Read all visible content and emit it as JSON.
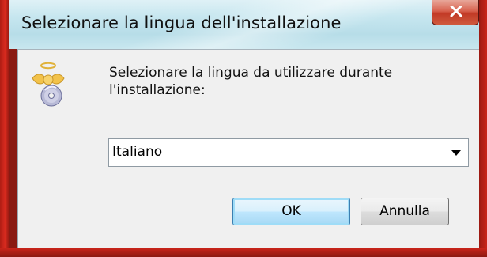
{
  "window": {
    "title": "Selezionare la lingua dell'installazione",
    "close_label": "X"
  },
  "dialog": {
    "prompt": "Selezionare la lingua da utilizzare durante l'installazione:",
    "language_select": {
      "selected": "Italiano"
    },
    "buttons": {
      "ok": "OK",
      "cancel": "Annulla"
    }
  },
  "icons": {
    "app": "setup-angel-cd-icon",
    "close": "close-icon",
    "dropdown": "chevron-down-icon"
  },
  "colors": {
    "frame_red": "#c9251a",
    "close_button": "#c23a26",
    "default_button_border": "#3c7fb1"
  }
}
